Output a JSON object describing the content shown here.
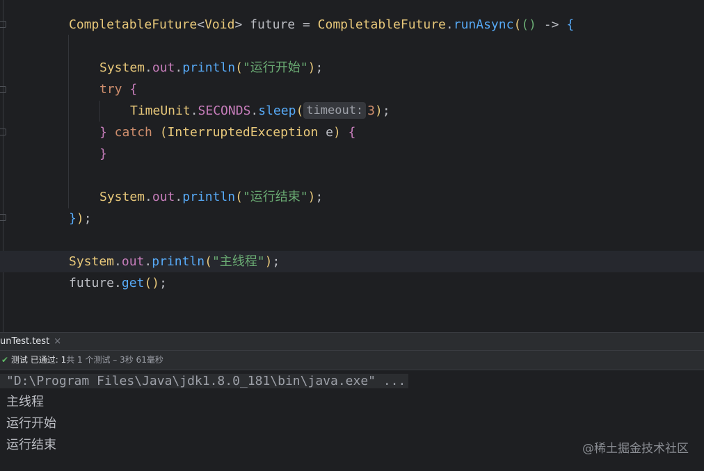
{
  "editor": {
    "line1": {
      "type": "CompletableFuture",
      "generic_open": "<",
      "generic_type": "Void",
      "generic_close": ">",
      "var": " future = ",
      "cls": "CompletableFuture",
      "dot": ".",
      "method": "runAsync",
      "paren_open": "(",
      "lambda_parens": "()",
      "arrow": " -> ",
      "brace": "{"
    },
    "line2": {
      "cls": "System",
      "dot1": ".",
      "field": "out",
      "dot2": ".",
      "method": "println",
      "po": "(",
      "str": "\"运行开始\"",
      "pc": ")",
      "semi": ";"
    },
    "line3": {
      "kw": "try",
      "brace": " {"
    },
    "line4": {
      "cls": "TimeUnit",
      "dot1": ".",
      "field": "SECONDS",
      "dot2": ".",
      "method": "sleep",
      "po": "(",
      "hint": "timeout:",
      "arg": "3",
      "pc": ")",
      "semi": ";"
    },
    "line5": {
      "close": "}",
      "kw": " catch ",
      "po": "(",
      "cls": "InterruptedException",
      "var": " e",
      "pc": ")",
      "brace": " {"
    },
    "line6": {
      "close": "}"
    },
    "line7": {
      "cls": "System",
      "dot1": ".",
      "field": "out",
      "dot2": ".",
      "method": "println",
      "po": "(",
      "str": "\"运行结束\"",
      "pc": ")",
      "semi": ";"
    },
    "line8": {
      "brace": "}",
      "paren": ")",
      "semi": ";"
    },
    "line9": {
      "cls": "System",
      "dot1": ".",
      "field": "out",
      "dot2": ".",
      "method": "println",
      "po": "(",
      "str": "\"主线程\"",
      "pc": ")",
      "semi": ";"
    },
    "line10": {
      "var": "future",
      "dot": ".",
      "method": "get",
      "parens": "()",
      "semi": ";"
    }
  },
  "run_panel": {
    "tab_label": "unTest.test",
    "tab_close": "×",
    "status": {
      "check": "✔",
      "prefix": "测试 已通过: ",
      "passed": "1",
      "detail": "共 1 个测试 – 3秒 61毫秒"
    },
    "console": [
      "\"D:\\Program Files\\Java\\jdk1.8.0_181\\bin\\java.exe\" ...",
      "主线程",
      "运行开始",
      "运行结束"
    ]
  },
  "watermark": "@稀土掘金技术社区",
  "colors": {
    "background": "#1e1f22",
    "keyword": "#cf8e6d",
    "class": "#e8c87a",
    "method": "#57aaf7",
    "string": "#6aab73",
    "field": "#c77dbb",
    "check": "#5fb865"
  }
}
